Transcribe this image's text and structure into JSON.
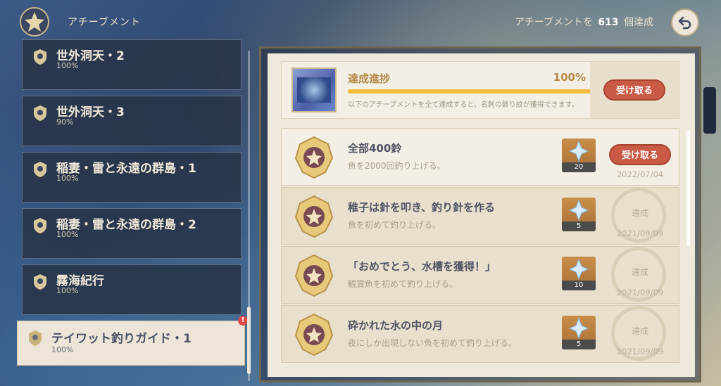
{
  "header": {
    "title": "アチーブメント",
    "count_prefix": "アチーブメントを",
    "count_value": "613",
    "count_suffix": "個達成"
  },
  "categories": [
    {
      "name": "世外洞天・2",
      "progress": "100%"
    },
    {
      "name": "世外洞天・3",
      "progress": "90%"
    },
    {
      "name": "稲妻・雷と永遠の群島・1",
      "progress": "100%"
    },
    {
      "name": "稲妻・雷と永遠の群島・2",
      "progress": "100%"
    },
    {
      "name": "霧海紀行",
      "progress": "100%"
    },
    {
      "name": "テイワット釣りガイド・1",
      "progress": "100%",
      "active": true,
      "alert": "!"
    }
  ],
  "summary": {
    "title": "達成進捗",
    "percent": "100%",
    "progress_fraction": 1.0,
    "description": "以下のアチーブメントを全て達成すると、名刺の飾り紋が獲得できます。",
    "claim_label": "受け取る"
  },
  "achievements": [
    {
      "name": "全部400鈴",
      "desc": "魚を2000回釣り上げる。",
      "reward_qty": "20",
      "status": "claim",
      "claim_label": "受け取る",
      "date": "2022/07/04"
    },
    {
      "name": "稚子は針を叩き、釣り針を作る",
      "desc": "魚を初めて釣り上げる。",
      "reward_qty": "5",
      "status": "done",
      "done_label": "達成",
      "date": "2021/09/09"
    },
    {
      "name": "「おめでとう、水槽を獲得！」",
      "desc": "観賞魚を初めて釣り上げる。",
      "reward_qty": "10",
      "status": "done",
      "done_label": "達成",
      "date": "2021/09/09"
    },
    {
      "name": "砕かれた水の中の月",
      "desc": "夜にしか出現しない魚を初めて釣り上げる。",
      "reward_qty": "5",
      "status": "done",
      "done_label": "達成",
      "date": "2021/09/09"
    }
  ],
  "colors": {
    "accent_gold": "#b48a4a",
    "claim_red": "#c95a46",
    "progress_yellow": "#f3bc3a",
    "panel_bg": "#efe9dc"
  },
  "icons": {
    "header": "achievement-trophy-icon",
    "back": "back-arrow-icon",
    "category": "category-medal-icon",
    "reward": "primogem-icon",
    "medal": "achievement-medal-icon"
  }
}
